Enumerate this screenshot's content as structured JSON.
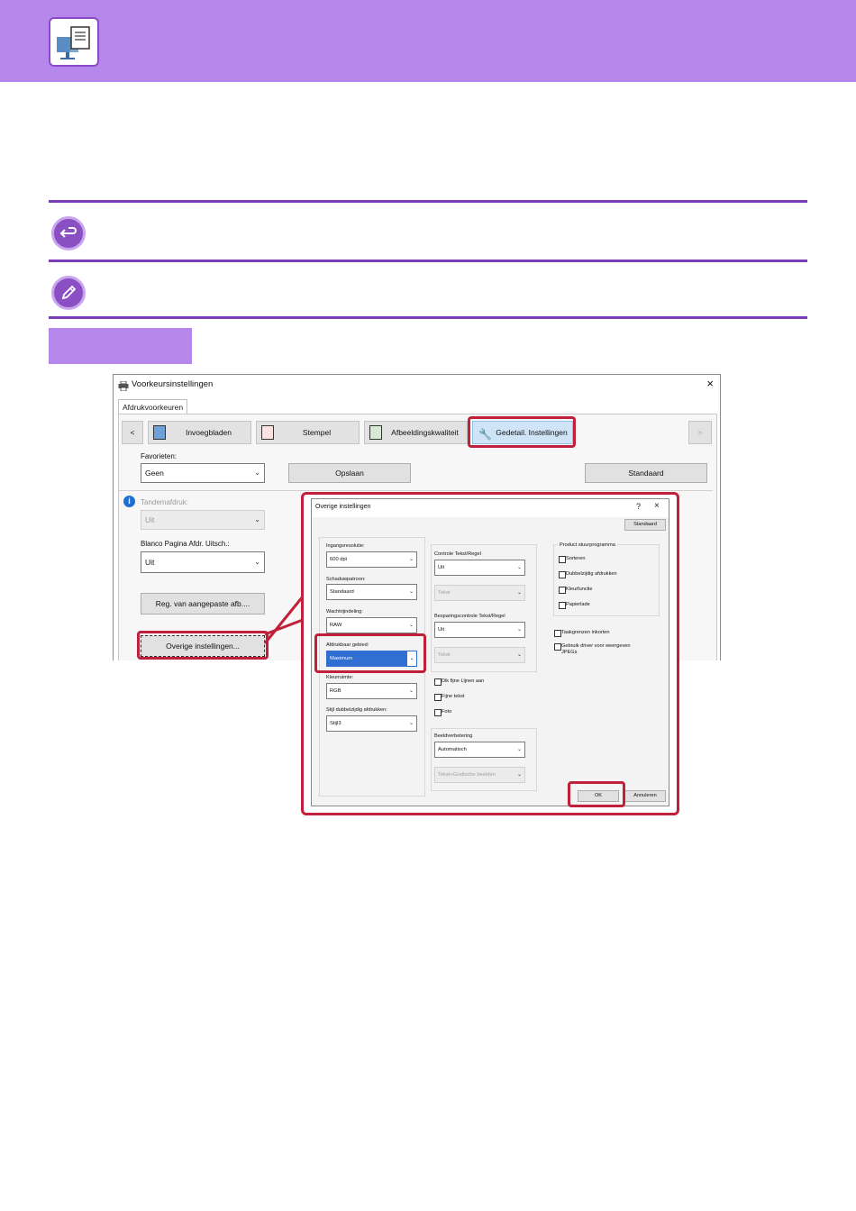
{
  "dialog": {
    "title": "Voorkeursinstellingen",
    "close": "×",
    "main_tab": "Afdrukvoorkeuren",
    "tabs": [
      {
        "label": "<"
      },
      {
        "label": "Invoegbladen"
      },
      {
        "label": "Stempel"
      },
      {
        "label": "Afbeeldingskwaliteit"
      },
      {
        "label": "Gedetail. Instellingen"
      },
      {
        "label": ">"
      }
    ],
    "favorites_label": "Favorieten:",
    "favorites_value": "Geen",
    "save_button": "Opslaan",
    "default_button": "Standaard",
    "tandem_label": "Tandemafdruk:",
    "tandem_value": "Uit",
    "blank_page_label": "Blanco Pagina Afdr. Uitsch.:",
    "blank_page_value": "Uit",
    "custom_image_button": "Reg. van aangepaste afb....",
    "other_settings_button": "Overige instellingen..."
  },
  "subdialog": {
    "title": "Overige instellingen",
    "help": "?",
    "close": "×",
    "default_button": "Standaard",
    "input_resolution_label": "Ingangsresolutie:",
    "input_resolution_value": "600 dpi",
    "shade_pattern_label": "Schaduwpatroon:",
    "shade_pattern_value": "Standaard",
    "spool_format_label": "Wachtrijindeling:",
    "spool_format_value": "RAW",
    "printable_area_label": "Afdrukbaar gebied:",
    "printable_area_value": "Maximum",
    "color_space_label": "Kleurruimte:",
    "color_space_value": "RGB",
    "duplex_style_label": "Stijl dubbelzijdig afdrukken:",
    "duplex_style_value": "Stijl3",
    "text_line_check_label": "Controle Tekst/Regel",
    "text_line_check_value": "Uit",
    "text_line_check_sub_value": "Tekst",
    "saving_check_label": "Besparingscontrole Tekst/Regel",
    "saving_check_value": "Uit",
    "saving_check_sub_value": "Tekst",
    "thick_lines": "Dik fijne Lijnen aan",
    "fine_text": "Fijne tekst",
    "photo": "Foto",
    "image_enhance_label": "Beeldverbetering",
    "image_enhance_value": "Automatisch",
    "image_enhance_sub_value": "Tekst+Grafische beelden",
    "driver_group_label": "Product stuurprogramma",
    "sort": "Sorteren",
    "duplex_print": "Dubbelzijdig afdrukken",
    "color_function": "Kleurfunctie",
    "paper_tray": "Papierlade",
    "fast_printing": "Taakgrenzen inkorten",
    "use_driver_jpeg": "Gebruik driver voor weergeven JPEGs",
    "ok_button": "OK",
    "cancel_button": "Annuleren"
  }
}
